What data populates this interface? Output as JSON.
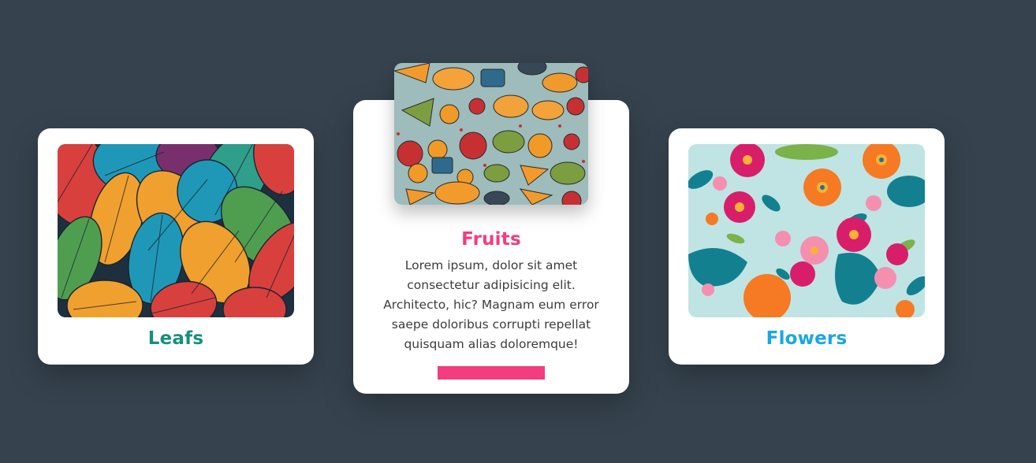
{
  "theme": {
    "background": "#36434e",
    "card_background": "#ffffff",
    "text": "#3c3c3c"
  },
  "cards": [
    {
      "title": "Leafs",
      "title_color": "#16907f",
      "image": "leaf-pattern-image"
    },
    {
      "title": "Fruits",
      "title_color": "#f23d7f",
      "image": "fruit-pattern-image",
      "description": "Lorem ipsum, dolor sit amet consectetur adipisicing elit. Architecto, hic? Magnam eum error saepe doloribus corrupti repellat quisquam alias doloremque!",
      "button_color": "#f23d7f"
    },
    {
      "title": "Flowers",
      "title_color": "#1aa7e0",
      "image": "flower-pattern-image"
    }
  ]
}
